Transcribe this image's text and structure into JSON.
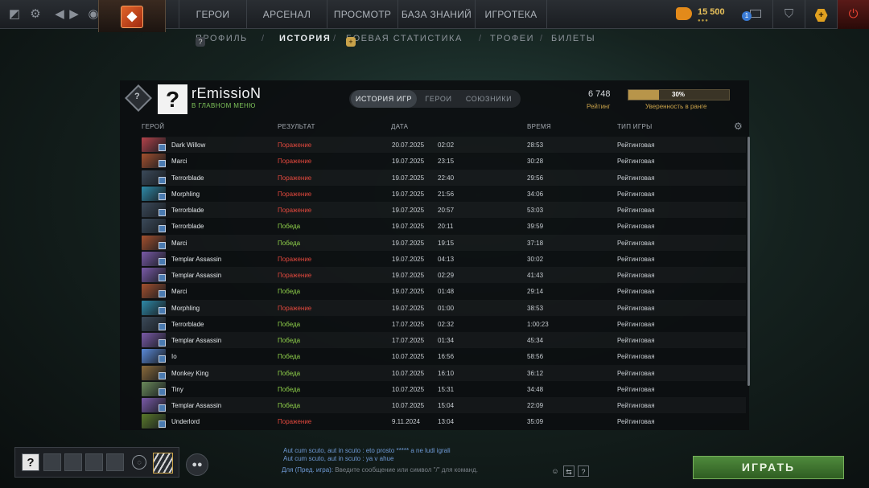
{
  "topbar": {
    "nav": [
      "ГЕРОИ",
      "АРСЕНАЛ",
      "ПРОСМОТР",
      "БАЗА ЗНАНИЙ",
      "ИГРОТЕКА"
    ],
    "currency": "15 500",
    "notifications": "1"
  },
  "subnav": {
    "items": [
      "ПРОФИЛЬ",
      "ИСТОРИЯ",
      "БОЕВАЯ СТАТИСТИКА",
      "ТРОФЕИ",
      "БИЛЕТЫ"
    ],
    "active": "ИСТОРИЯ"
  },
  "profile": {
    "name": "rEmissioN",
    "status": "В ГЛАВНОМ МЕНЮ",
    "avatar_text": "?",
    "rank_text": "?",
    "rating_value": "6 748",
    "rating_label": "Рейтинг",
    "confidence_value": 30,
    "confidence_text": "30%",
    "confidence_label": "Уверенность в ранге"
  },
  "tabs": [
    "ИСТОРИЯ ИГР",
    "ГЕРОИ",
    "СОЮЗНИКИ"
  ],
  "columns": [
    "ГЕРОЙ",
    "РЕЗУЛЬТАТ",
    "ДАТА",
    "ВРЕМЯ",
    "ТИП ИГРЫ"
  ],
  "matches": [
    {
      "hero": "Dark Willow",
      "result": "Поражение",
      "win": false,
      "date": "20.07.2025",
      "time": "02:02",
      "duration": "28:53",
      "mode": "Рейтинговая",
      "color": "#b3424a"
    },
    {
      "hero": "Marci",
      "result": "Поражение",
      "win": false,
      "date": "19.07.2025",
      "time": "23:15",
      "duration": "30:28",
      "mode": "Рейтинговая",
      "color": "#a4502e"
    },
    {
      "hero": "Terrorblade",
      "result": "Поражение",
      "win": false,
      "date": "19.07.2025",
      "time": "22:40",
      "duration": "29:56",
      "mode": "Рейтинговая",
      "color": "#3b4a5a"
    },
    {
      "hero": "Morphling",
      "result": "Поражение",
      "win": false,
      "date": "19.07.2025",
      "time": "21:56",
      "duration": "34:06",
      "mode": "Рейтинговая",
      "color": "#2e8aa8"
    },
    {
      "hero": "Terrorblade",
      "result": "Поражение",
      "win": false,
      "date": "19.07.2025",
      "time": "20:57",
      "duration": "53:03",
      "mode": "Рейтинговая",
      "color": "#3b4a5a"
    },
    {
      "hero": "Terrorblade",
      "result": "Победа",
      "win": true,
      "date": "19.07.2025",
      "time": "20:11",
      "duration": "39:59",
      "mode": "Рейтинговая",
      "color": "#3b4a5a"
    },
    {
      "hero": "Marci",
      "result": "Победа",
      "win": true,
      "date": "19.07.2025",
      "time": "19:15",
      "duration": "37:18",
      "mode": "Рейтинговая",
      "color": "#a4502e"
    },
    {
      "hero": "Templar Assassin",
      "result": "Поражение",
      "win": false,
      "date": "19.07.2025",
      "time": "04:13",
      "duration": "30:02",
      "mode": "Рейтинговая",
      "color": "#7a5aa8"
    },
    {
      "hero": "Templar Assassin",
      "result": "Поражение",
      "win": false,
      "date": "19.07.2025",
      "time": "02:29",
      "duration": "41:43",
      "mode": "Рейтинговая",
      "color": "#7a5aa8"
    },
    {
      "hero": "Marci",
      "result": "Победа",
      "win": true,
      "date": "19.07.2025",
      "time": "01:48",
      "duration": "29:14",
      "mode": "Рейтинговая",
      "color": "#a4502e"
    },
    {
      "hero": "Morphling",
      "result": "Поражение",
      "win": false,
      "date": "19.07.2025",
      "time": "01:00",
      "duration": "38:53",
      "mode": "Рейтинговая",
      "color": "#2e8aa8"
    },
    {
      "hero": "Terrorblade",
      "result": "Победа",
      "win": true,
      "date": "17.07.2025",
      "time": "02:32",
      "duration": "1:00:23",
      "mode": "Рейтинговая",
      "color": "#3b4a5a"
    },
    {
      "hero": "Templar Assassin",
      "result": "Победа",
      "win": true,
      "date": "17.07.2025",
      "time": "01:34",
      "duration": "45:34",
      "mode": "Рейтинговая",
      "color": "#7a5aa8"
    },
    {
      "hero": "Io",
      "result": "Победа",
      "win": true,
      "date": "10.07.2025",
      "time": "16:56",
      "duration": "58:56",
      "mode": "Рейтинговая",
      "color": "#5a8ad8"
    },
    {
      "hero": "Monkey King",
      "result": "Победа",
      "win": true,
      "date": "10.07.2025",
      "time": "16:10",
      "duration": "36:12",
      "mode": "Рейтинговая",
      "color": "#8a6a3a"
    },
    {
      "hero": "Tiny",
      "result": "Победа",
      "win": true,
      "date": "10.07.2025",
      "time": "15:31",
      "duration": "34:48",
      "mode": "Рейтинговая",
      "color": "#6a8a5a"
    },
    {
      "hero": "Templar Assassin",
      "result": "Победа",
      "win": true,
      "date": "10.07.2025",
      "time": "15:04",
      "duration": "22:09",
      "mode": "Рейтинговая",
      "color": "#7a5aa8"
    },
    {
      "hero": "Underlord",
      "result": "Поражение",
      "win": false,
      "date": "9.11.2024",
      "time": "13:04",
      "duration": "35:09",
      "mode": "Рейтинговая",
      "color": "#5a7a2a"
    }
  ],
  "party": {
    "self": "?"
  },
  "chat": {
    "lines": [
      {
        "who": "Aut cum scuto, aut in scuto",
        "msg": ": eto prosto ***** a ne ludi igrali"
      },
      {
        "who": "Aut cum scuto, aut in scuto",
        "msg": ": ya v ahue"
      }
    ],
    "channel": "Для (Пред. игра):",
    "placeholder": "Введите сообщение или символ \"/\" для команд."
  },
  "play_label": "ИГРАТЬ",
  "colors": {
    "win": "#8fd04a",
    "loss": "#e2483d",
    "accent": "#c9a24a",
    "play": "#4f8a3c"
  }
}
